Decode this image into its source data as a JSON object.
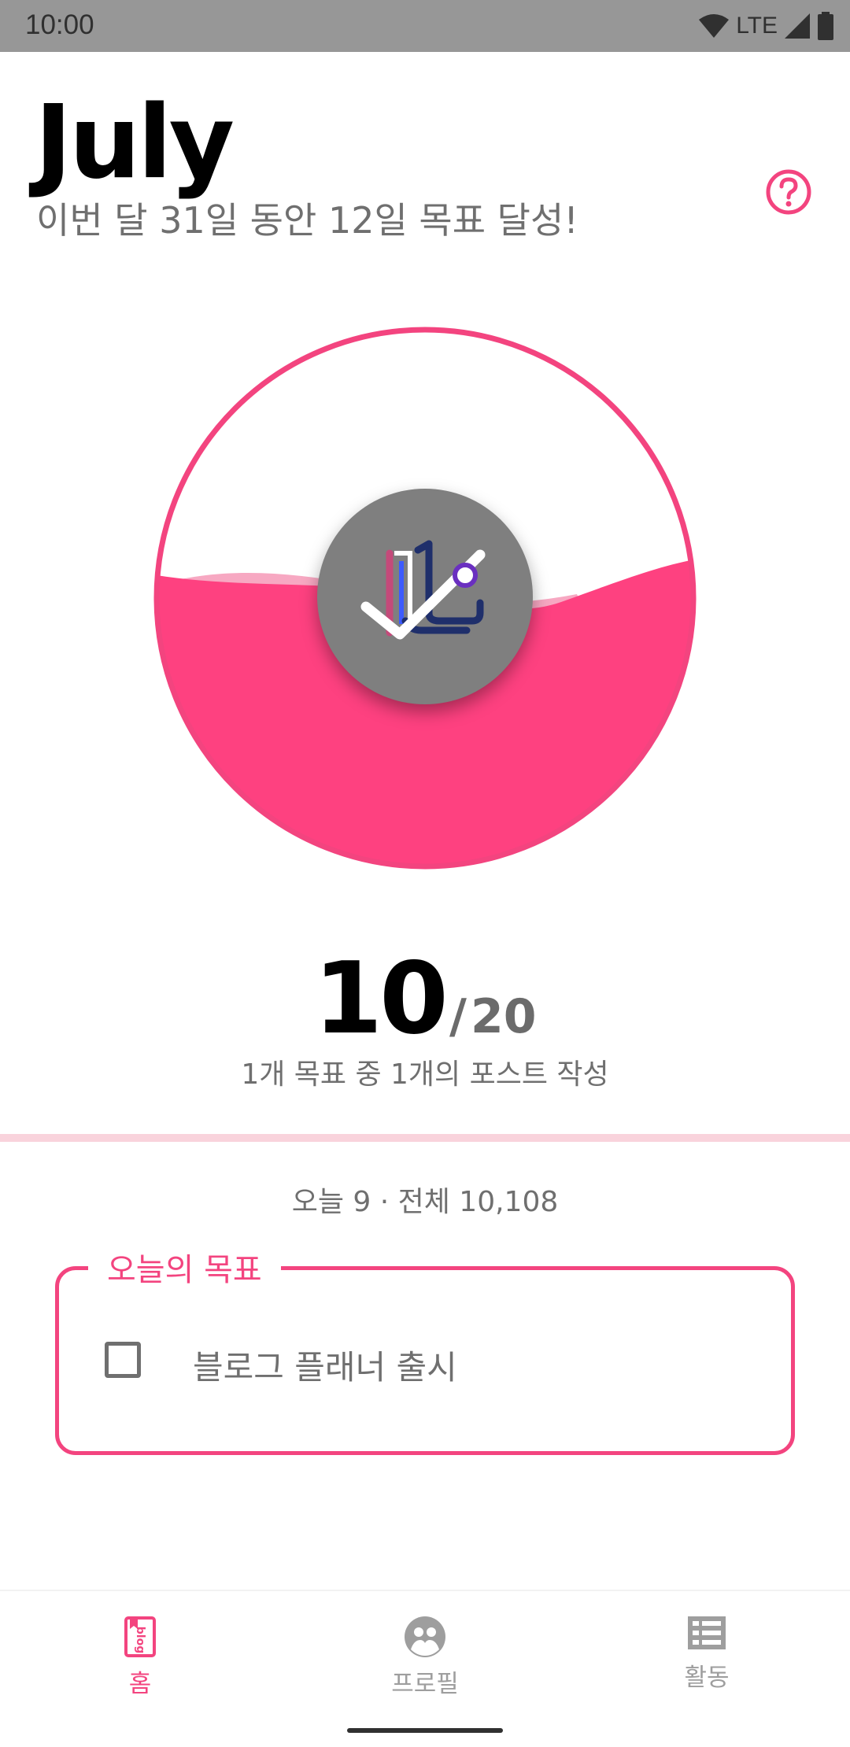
{
  "status_bar": {
    "time": "10:00",
    "network": "LTE",
    "icons": [
      "wifi-icon",
      "signal-icon",
      "battery-icon"
    ]
  },
  "header": {
    "month": "July",
    "subtitle": "이번 달 31일 동안 12일 목표 달성!",
    "help_icon": "question-circle-icon"
  },
  "gauge": {
    "fill_fraction": 0.5,
    "current": "10",
    "separator": "/",
    "target": "20",
    "caption": "1개 목표 중 1개의 포스트 작성"
  },
  "stats": {
    "text": "오늘 9 · 전체 10,108"
  },
  "goals": {
    "title": "오늘의 목표",
    "items": [
      {
        "label": "블로그 플래너 출시",
        "checked": false
      }
    ]
  },
  "nav": {
    "items": [
      {
        "label": "홈",
        "icon": "blog-icon",
        "active": true
      },
      {
        "label": "프로필",
        "icon": "profile-icon",
        "active": false
      },
      {
        "label": "활동",
        "icon": "list-icon",
        "active": false
      }
    ]
  },
  "colors": {
    "accent": "#f3447f",
    "accent_fill": "#fe4180",
    "accent_light": "#f9d3dc",
    "text_gray": "#6f6f6f",
    "status_bar": "#979797"
  }
}
